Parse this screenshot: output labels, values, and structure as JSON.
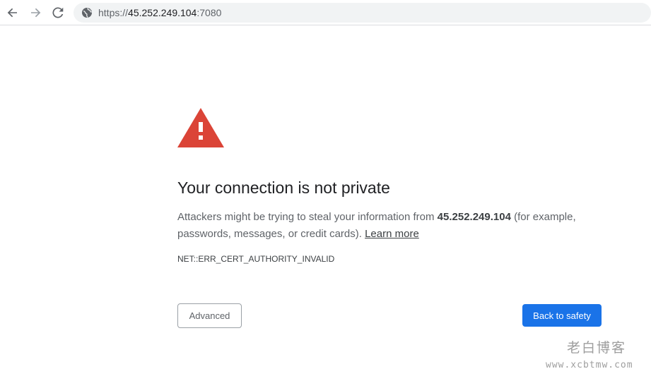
{
  "browser": {
    "url_scheme": "https://",
    "url_host": "45.252.249.104",
    "url_port": ":7080",
    "icons": {
      "back": "arrow-left-icon",
      "forward": "arrow-right-icon",
      "reload": "reload-icon",
      "site_info": "globe-icon"
    }
  },
  "interstitial": {
    "icon": "warning-triangle-icon",
    "heading": "Your connection is not private",
    "body_prefix": "Attackers might be trying to steal your information from ",
    "body_host": "45.252.249.104",
    "body_suffix": " (for example, passwords, messages, or credit cards). ",
    "learn_more": "Learn more",
    "error_code": "NET::ERR_CERT_AUTHORITY_INVALID",
    "advanced_label": "Advanced",
    "back_to_safety_label": "Back to safety"
  },
  "watermark": {
    "site_name": "老白博客",
    "site_url": "www.xcbtmw.com"
  },
  "colors": {
    "warning_red": "#db4437",
    "primary_blue": "#1a73e8",
    "text_dark": "#202124",
    "text_muted": "#5f6368"
  }
}
